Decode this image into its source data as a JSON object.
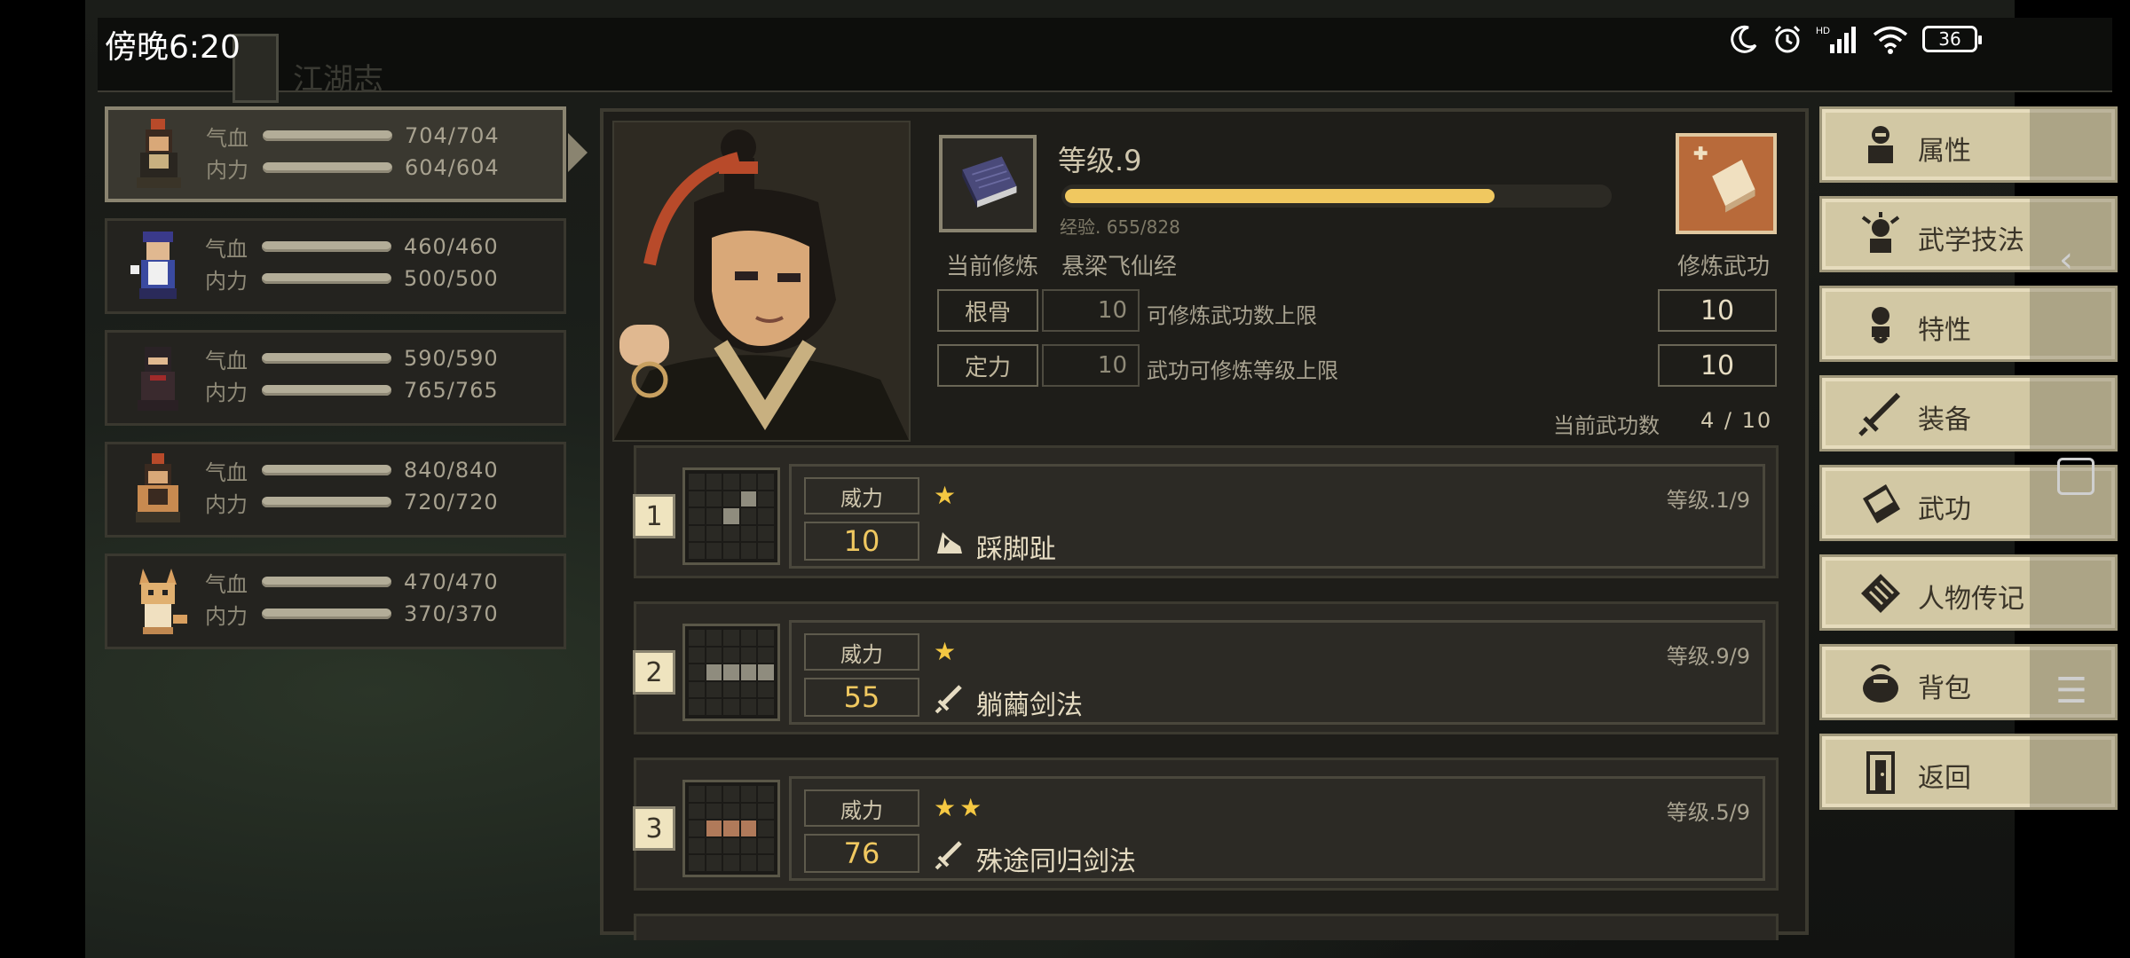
{
  "status_bar": {
    "time": "傍晚6:20",
    "battery": "36"
  },
  "title": "江湖志",
  "party": [
    {
      "hp_label": "气血",
      "hp": "704/704",
      "mp_label": "内力",
      "mp": "604/604",
      "hp_fraction": 1.0,
      "mp_fraction": 1.0,
      "active": true
    },
    {
      "hp_label": "气血",
      "hp": "460/460",
      "mp_label": "内力",
      "mp": "500/500",
      "hp_fraction": 1.0,
      "mp_fraction": 1.0
    },
    {
      "hp_label": "气血",
      "hp": "590/590",
      "mp_label": "内力",
      "mp": "765/765",
      "hp_fraction": 1.0,
      "mp_fraction": 1.0
    },
    {
      "hp_label": "气血",
      "hp": "840/840",
      "mp_label": "内力",
      "mp": "720/720",
      "hp_fraction": 1.0,
      "mp_fraction": 1.0
    },
    {
      "hp_label": "气血",
      "hp": "470/470",
      "mp_label": "内力",
      "mp": "370/370",
      "hp_fraction": 1.0,
      "mp_fraction": 1.0
    }
  ],
  "training": {
    "level_label": "等级.9",
    "xp_text": "经验. 655/828",
    "xp_fraction": 0.791,
    "current_label": "当前修炼",
    "current_value": "悬梁飞仙经",
    "train_label": "修炼武功"
  },
  "stats": [
    {
      "name": "根骨",
      "value": "10",
      "desc": "可修炼武功数上限",
      "result": "10"
    },
    {
      "name": "定力",
      "value": "10",
      "desc": "武功可修炼等级上限",
      "result": "10"
    }
  ],
  "skill_count": {
    "label": "当前武功数",
    "value": "4 / 10"
  },
  "skills": [
    {
      "index": "1",
      "power_label": "威力",
      "power": "10",
      "stars": "★",
      "name": "踩脚趾",
      "level": "等级.1/9"
    },
    {
      "index": "2",
      "power_label": "威力",
      "power": "55",
      "stars": "★",
      "name": "躺繭剑法",
      "level": "等级.9/9"
    },
    {
      "index": "3",
      "power_label": "威力",
      "power": "76",
      "stars": "★★",
      "name": "殊途同归剑法",
      "level": "等级.5/9"
    }
  ],
  "menu": [
    {
      "label": "属性",
      "icon": "person-icon"
    },
    {
      "label": "武学技法",
      "icon": "technique-icon"
    },
    {
      "label": "特性",
      "icon": "trait-icon"
    },
    {
      "label": "装备",
      "icon": "sword-icon"
    },
    {
      "label": "武功",
      "icon": "book-icon"
    },
    {
      "label": "人物传记",
      "icon": "scroll-icon"
    },
    {
      "label": "背包",
      "icon": "bag-icon"
    },
    {
      "label": "返回",
      "icon": "door-icon"
    }
  ],
  "colors": {
    "accent_gold": "#f0c860",
    "panel": "#24231f",
    "menu_bg": "#d2c8a4",
    "star": "#f5c842"
  }
}
